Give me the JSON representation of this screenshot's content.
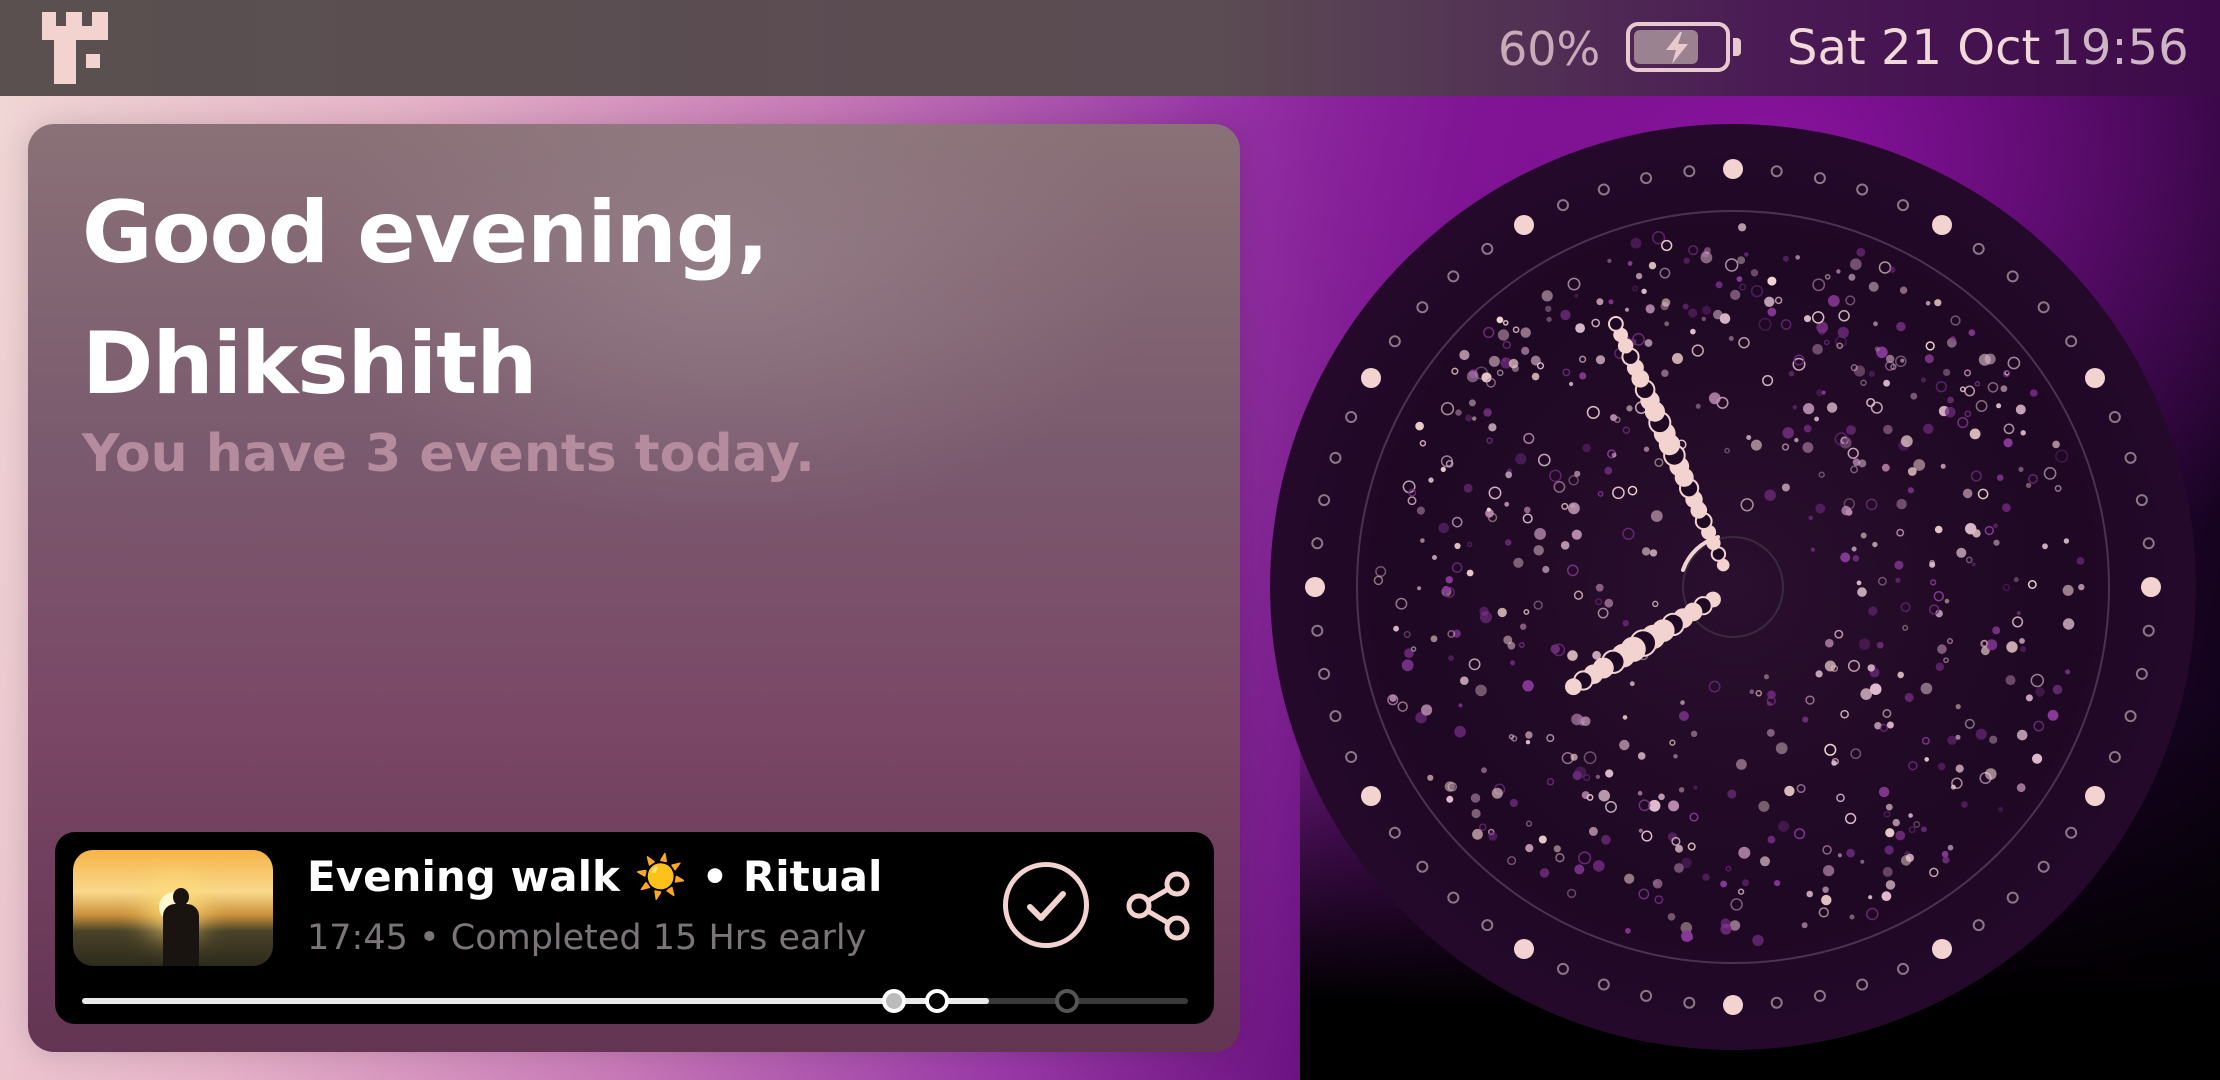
{
  "status_bar": {
    "battery_percent": "60%",
    "date": "Sat 21 Oct",
    "time": "19:56",
    "icons": [
      "app-logo-icon",
      "battery-charging-icon"
    ]
  },
  "greeting": {
    "line1": "Good evening,",
    "line2": "Dhikshith",
    "subtitle": "You have 3 events today."
  },
  "now_playing": {
    "title": "Evening walk ☀️ • Ritual",
    "subtitle": "17:45 • Completed 15 Hrs early",
    "progress": 0.82,
    "icons": [
      "thumbnail-image",
      "check-circle-icon",
      "share-icon"
    ]
  },
  "clock": {
    "time": "19:56",
    "hour": 19,
    "minute": 56
  },
  "colors": {
    "accent": "#f2d3d0",
    "card": "#7a4766",
    "media_bg": "#000000",
    "clock_face": "#1f0a24"
  }
}
